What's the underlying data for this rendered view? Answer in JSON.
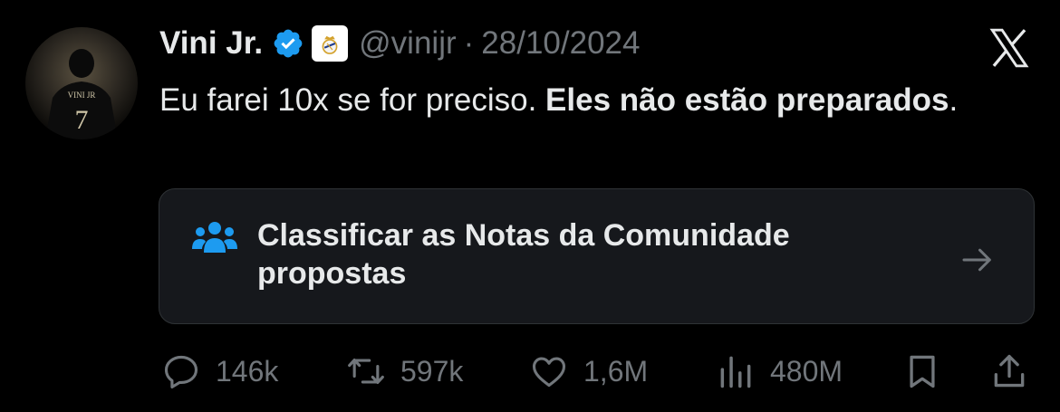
{
  "tweet": {
    "author_name": "Vini Jr.",
    "handle": "@vinijr",
    "separator": "·",
    "date": "28/10/2024",
    "avatar_jersey_text": "VINI JR",
    "text_regular": "Eu farei 10x se for preciso. ",
    "text_bold_1": "Eles não estão preparados",
    "text_end": "."
  },
  "community_notes": {
    "label": "Classificar as Notas da Comunidade propostas"
  },
  "actions": {
    "replies": "146k",
    "reposts": "597k",
    "likes": "1,6M",
    "views": "480M"
  },
  "colors": {
    "background": "#000000",
    "text_primary": "#e7e9ea",
    "text_secondary": "#71767b",
    "verified_blue": "#1d9bf0",
    "card_background": "#16181c"
  }
}
